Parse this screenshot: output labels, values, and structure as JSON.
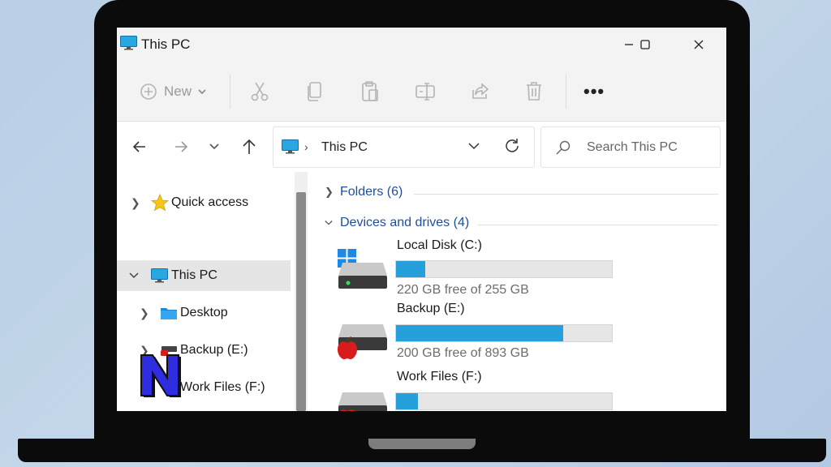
{
  "window": {
    "title": "This PC",
    "minimize_icon": "minimize-icon",
    "maximize_icon": "maximize-icon",
    "close_icon": "close-icon"
  },
  "toolbar": {
    "new_label": "New",
    "buttons": [
      "cut-icon",
      "copy-icon",
      "paste-icon",
      "rename-icon",
      "share-icon",
      "delete-icon"
    ],
    "more_label": "•••"
  },
  "address": {
    "path_label": "This PC",
    "chevron": "›"
  },
  "search": {
    "placeholder": "Search This PC"
  },
  "nav_pane": {
    "items": [
      {
        "label": "Quick access",
        "icon": "star-icon",
        "expanded": false,
        "selected": false
      },
      {
        "label": "This PC",
        "icon": "monitor-icon",
        "expanded": true,
        "selected": true
      },
      {
        "label": "Desktop",
        "icon": "folder-icon",
        "expanded": false,
        "selected": false
      },
      {
        "label": "Backup (E:)",
        "icon": "usb-drive-icon",
        "expanded": false,
        "selected": false
      },
      {
        "label": "Work Files (F:)",
        "icon": "n-logo-icon",
        "expanded": false,
        "selected": false
      }
    ]
  },
  "content": {
    "folders_group": "Folders (6)",
    "devices_group": "Devices and drives (4)",
    "drives": [
      {
        "name": "Local Disk (C:)",
        "free_text": "220 GB free of 255 GB",
        "used_fraction": 0.137,
        "badge": "windows-logo-icon"
      },
      {
        "name": "Backup (E:)",
        "free_text": "200 GB free of 893 GB",
        "used_fraction": 0.776,
        "badge": "apple-icon"
      },
      {
        "name": "Work Files (F:)",
        "free_text": "",
        "used_fraction": 0.1,
        "badge": "apple-icon"
      }
    ]
  },
  "colors": {
    "accent": "#26a0da",
    "group_text": "#1f4e9c",
    "selected_bg": "#e5e5e5"
  }
}
